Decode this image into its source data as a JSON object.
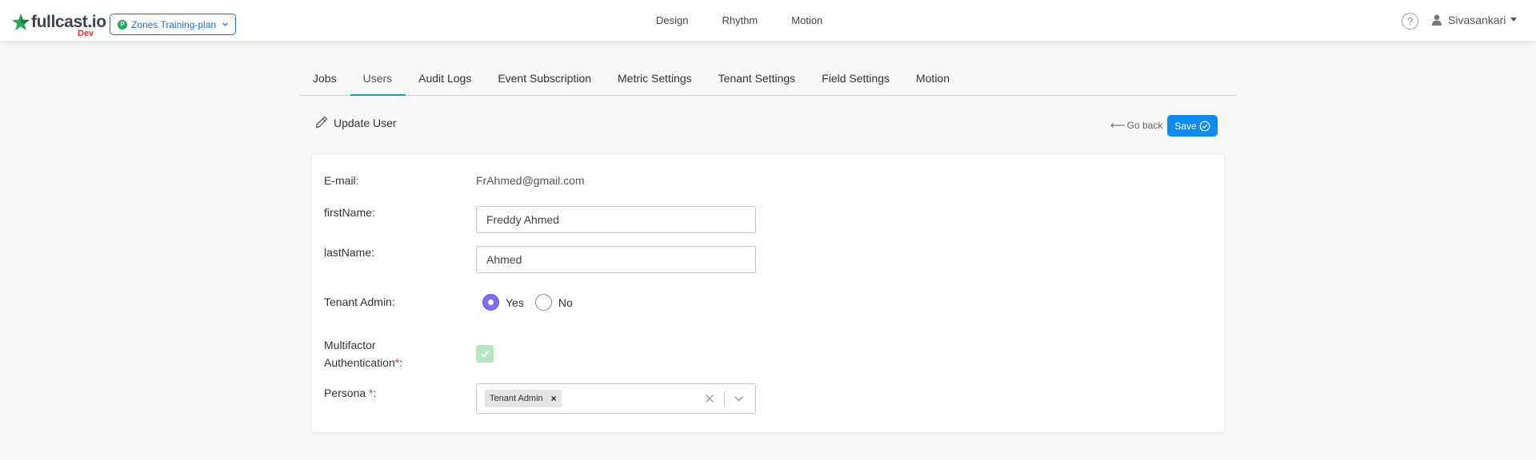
{
  "header": {
    "logo_text": "fullcast.io",
    "logo_badge": "Dev",
    "plan_selector": {
      "icon_letter": "P",
      "label": "Zones Training-plan"
    },
    "nav": [
      {
        "label": "Design"
      },
      {
        "label": "Rhythm"
      },
      {
        "label": "Motion"
      }
    ],
    "help_glyph": "?",
    "user_name": "Sivasankari"
  },
  "tabs": [
    {
      "label": "Jobs",
      "active": false
    },
    {
      "label": "Users",
      "active": true
    },
    {
      "label": "Audit Logs",
      "active": false
    },
    {
      "label": "Event Subscription",
      "active": false
    },
    {
      "label": "Metric Settings",
      "active": false
    },
    {
      "label": "Tenant Settings",
      "active": false
    },
    {
      "label": "Field Settings",
      "active": false
    },
    {
      "label": "Motion",
      "active": false
    }
  ],
  "section": {
    "title": "Update User",
    "go_back_label": "Go back",
    "save_label": "Save"
  },
  "form": {
    "email": {
      "label": "E-mail:",
      "value": "FrAhmed@gmail.com"
    },
    "first_name": {
      "label": "firstName:",
      "value": "Freddy Ahmed"
    },
    "last_name": {
      "label": "lastName:",
      "value": "Ahmed"
    },
    "tenant_admin": {
      "label": "Tenant Admin:",
      "options": [
        {
          "label": "Yes",
          "checked": true
        },
        {
          "label": "No",
          "checked": false
        }
      ]
    },
    "mfa": {
      "label_line1": "Multifactor",
      "label_line2": "Authentication",
      "required_mark": "*",
      "suffix": ":",
      "checked": true
    },
    "persona": {
      "label": "Persona ",
      "required_mark": "*",
      "suffix": ":",
      "selected": [
        "Tenant Admin"
      ],
      "chip_remove": "×"
    }
  },
  "colors": {
    "brand_blue": "#1e6fd9",
    "save_blue": "#0d8bf0",
    "tab_accent": "#17a2a3",
    "radio_checked": "#7b6cf0",
    "checkbox_checked": "#b8e6c3",
    "required": "#e0312f"
  },
  "icons": {
    "logo": "star-icon",
    "plan_chevron": "chevron-down-icon",
    "help": "help-icon",
    "user": "user-icon",
    "user_caret": "caret-down-icon",
    "edit": "pencil-icon",
    "go_back": "arrow-left-icon",
    "save": "check-circle-icon",
    "mfa": "check-icon",
    "clear": "close-icon",
    "select_chevron": "chevron-down-icon"
  }
}
